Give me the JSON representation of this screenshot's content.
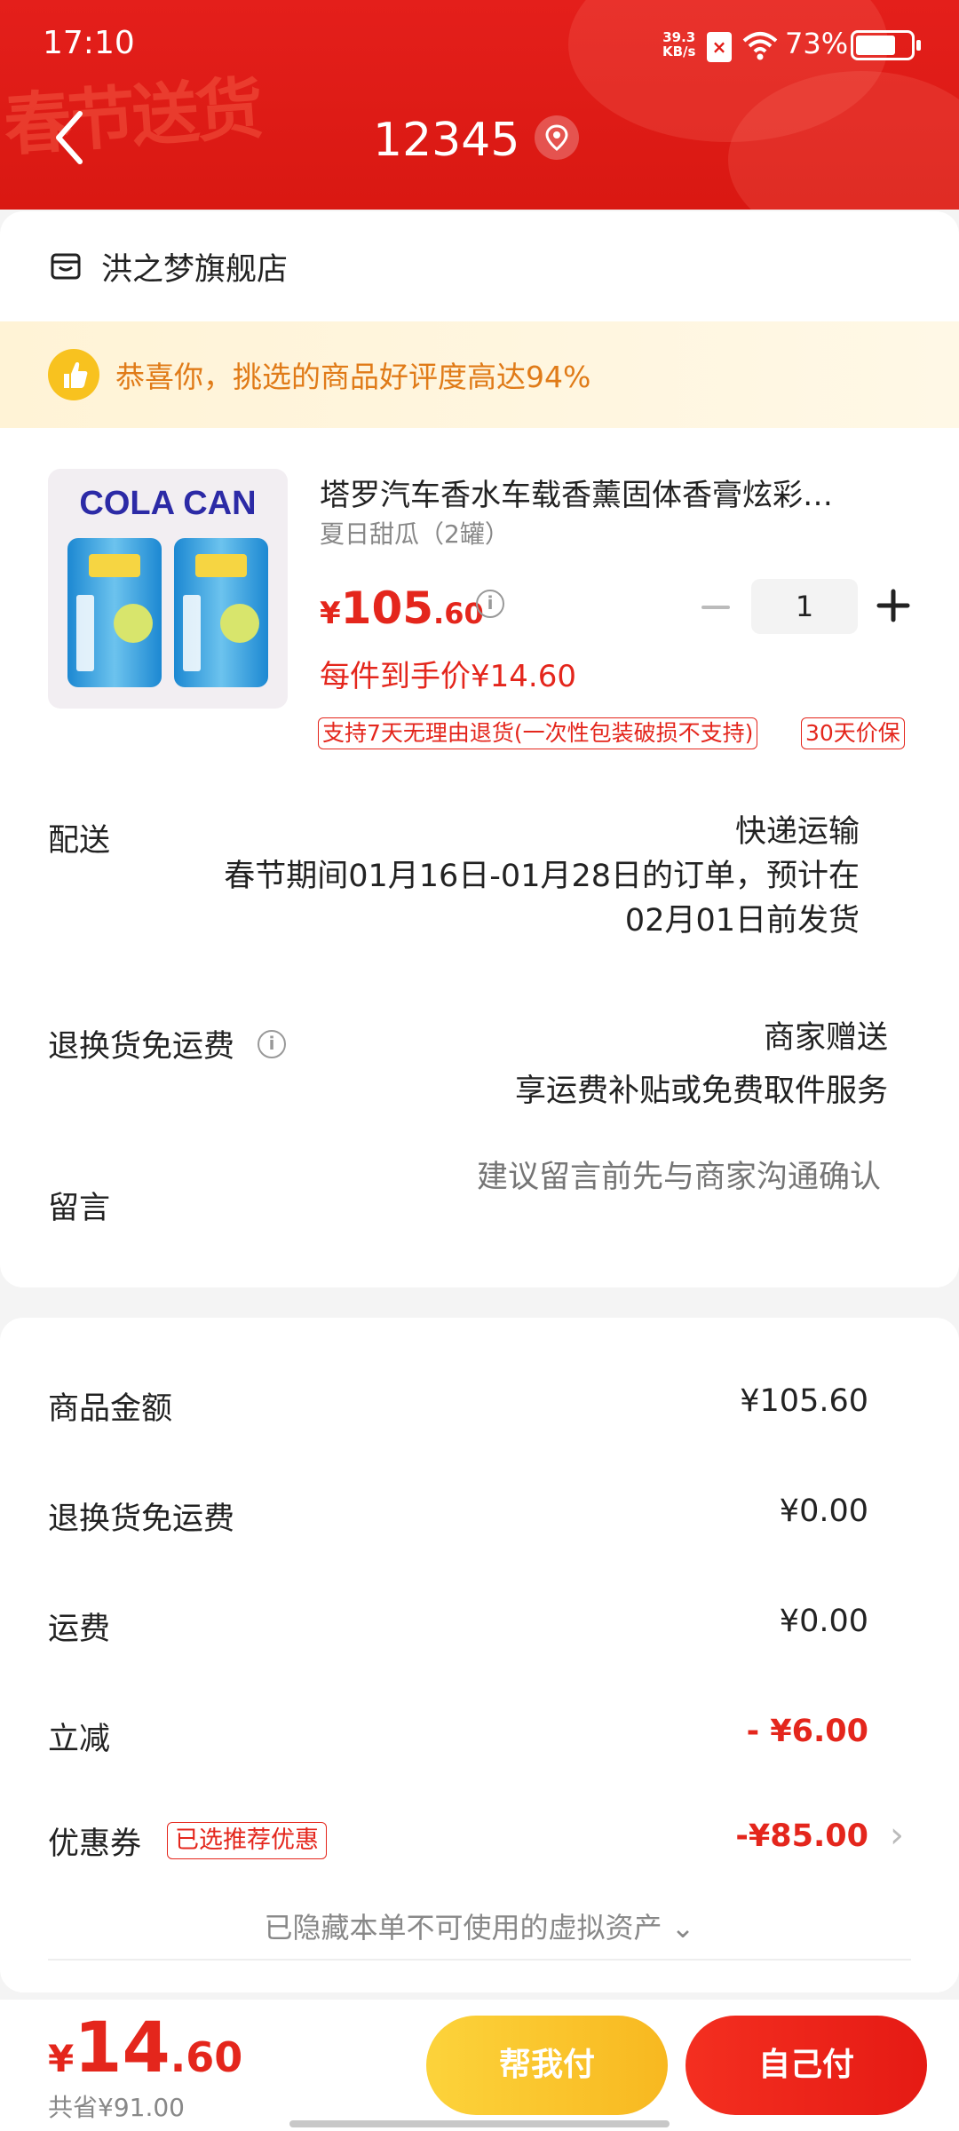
{
  "status_bar": {
    "time": "17:10",
    "net_speed_value": "39.3",
    "net_speed_unit": "KB/s",
    "battery_percent": "73%",
    "battery_level": 0.73
  },
  "header": {
    "title": "12345",
    "banner_text": "春节送货"
  },
  "store": {
    "name": "洪之梦旗舰店"
  },
  "praise": {
    "text": "恭喜你，挑选的商品好评度高达94%"
  },
  "product": {
    "image_brand": "COLA CAN",
    "title": "塔罗汽车香水车载香薰固体香膏炫彩…",
    "spec": "夏日甜瓜（2罐）",
    "price_currency": "¥",
    "price_int": "105",
    "price_dec": ".60",
    "unit_price": "每件到手价¥14.60",
    "quantity": "1",
    "tags": [
      "支持7天无理由退货(一次性包装破损不支持)",
      "30天价保"
    ]
  },
  "delivery": {
    "label": "配送",
    "method": "快递运输",
    "note_line1": "春节期间01月16日-01月28日的订单，预计在",
    "note_line2": "02月01日前发货"
  },
  "return_shipping": {
    "label": "退换货免运费",
    "value": "商家赠送",
    "sub": "享运费补贴或免费取件服务"
  },
  "message": {
    "label": "留言",
    "placeholder": "建议留言前先与商家沟通确认"
  },
  "summary": {
    "goods_label": "商品金额",
    "goods_value": "¥105.60",
    "return_label": "退换货免运费",
    "return_value": "¥0.00",
    "freight_label": "运费",
    "freight_value": "¥0.00",
    "discount_label": "立减",
    "discount_value": "- ¥6.00",
    "coupon_label": "优惠券",
    "coupon_tag": "已选推荐优惠",
    "coupon_value": "-¥85.00",
    "hidden_note": "已隐藏本单不可使用的虚拟资产 ⌄"
  },
  "footer": {
    "total_currency": "¥",
    "total_int": "14",
    "total_dec": ".60",
    "saved": "共省¥91.00",
    "help_pay": "帮我付",
    "self_pay": "自己付"
  },
  "colors": {
    "brand_red": "#e4261c",
    "header_red": "#e21b16",
    "gold": "#f8c21f"
  },
  "icons": [
    "back-arrow-icon",
    "location-pin-icon",
    "store-icon",
    "thumbs-up-icon",
    "info-icon",
    "minus-icon",
    "plus-icon",
    "chevron-right-icon",
    "wifi-icon",
    "battery-icon"
  ]
}
